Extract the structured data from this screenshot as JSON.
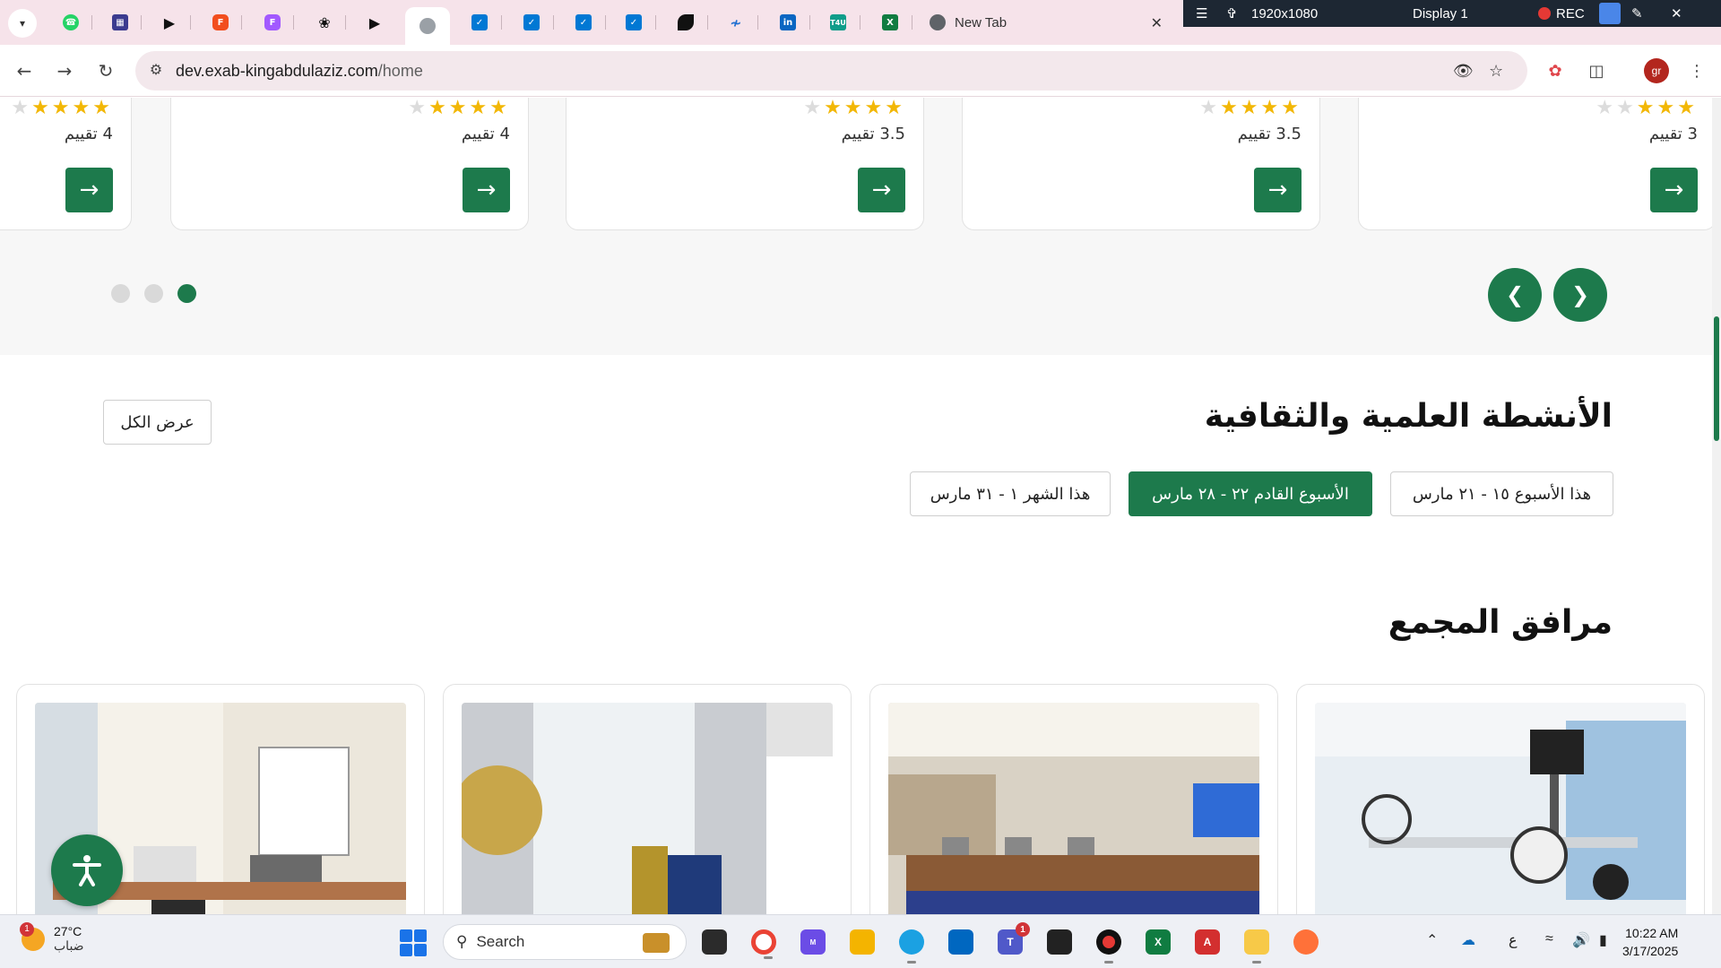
{
  "browser": {
    "new_tab_title": "New Tab",
    "url_host": "dev.exab-kingabdulaziz.com",
    "url_path": "/home",
    "profile_initials": "gr",
    "tabs": [
      {
        "icon": "whatsapp-icon",
        "color": "#25d366"
      },
      {
        "icon": "app-grid-icon",
        "color": "#3b3b8f"
      },
      {
        "icon": "play-icon",
        "color": "#111111"
      },
      {
        "icon": "figma-icon",
        "color": "#f24e1e"
      },
      {
        "icon": "figma-icon",
        "color": "#f24e1e"
      },
      {
        "icon": "openai-icon",
        "color": "#111111"
      },
      {
        "icon": "play-icon",
        "color": "#111111"
      },
      {
        "icon": "site-logo-icon",
        "color": "#666666"
      },
      {
        "icon": "azure-devops-icon",
        "color": "#0078d4"
      },
      {
        "icon": "azure-devops-icon",
        "color": "#0078d4"
      },
      {
        "icon": "azure-devops-icon",
        "color": "#0078d4"
      },
      {
        "icon": "azure-devops-icon",
        "color": "#0078d4"
      },
      {
        "icon": "leaf-icon",
        "color": "#111111"
      },
      {
        "icon": "wave-icon",
        "color": "#1f6fd1"
      },
      {
        "icon": "linkedin-icon",
        "color": "#0a66c2"
      },
      {
        "icon": "t4u-icon",
        "color": "#0f9d8a"
      },
      {
        "icon": "excel-icon",
        "color": "#107c41"
      }
    ]
  },
  "recorder": {
    "resolution": "1920x1080",
    "display": "Display 1",
    "rec_label": "REC"
  },
  "carousel": {
    "cards": [
      {
        "rating_text": "3 تقييم",
        "stars_on": 3
      },
      {
        "rating_text": "3.5 تقييم",
        "stars_on": 3.5
      },
      {
        "rating_text": "3.5 تقييم",
        "stars_on": 3.5
      },
      {
        "rating_text": "4 تقييم",
        "stars_on": 4
      },
      {
        "rating_text": "4 تقييم",
        "stars_on": 4
      }
    ],
    "page_count": 3,
    "active_page": 3
  },
  "activities": {
    "title": "الأنشطة العلمية والثقافية",
    "view_all": "عرض الكل",
    "filters": [
      {
        "label": "هذا الأسبوع ١٥ - ٢١ مارس",
        "active": false
      },
      {
        "label": "الأسبوع القادم ٢٢ - ٢٨ مارس",
        "active": true
      },
      {
        "label": "هذا الشهر ١ - ٣١ مارس",
        "active": false
      }
    ]
  },
  "facilities": {
    "title": "مرافق المجمع",
    "items": [
      {
        "image": "laboratory-microscope-photo"
      },
      {
        "image": "conference-hall-photo"
      },
      {
        "image": "exhibition-artifact-photo"
      },
      {
        "image": "scanning-room-photo"
      }
    ]
  },
  "taskbar": {
    "weather_temp": "27°C",
    "weather_condition": "ضباب",
    "weather_badge": "1",
    "search_label": "Search",
    "teams_badge": "1",
    "language": "ع",
    "time": "10:22 AM",
    "date": "3/17/2025"
  },
  "colors": {
    "brand_green": "#1d7a4c",
    "star_gold": "#f2b705",
    "tabstrip_bg": "#f6e3ea"
  }
}
